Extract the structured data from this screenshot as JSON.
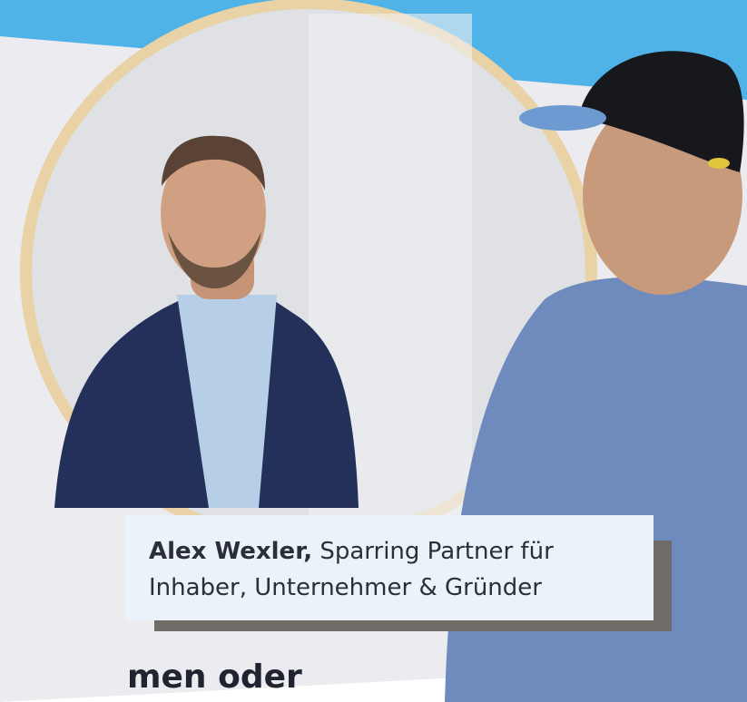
{
  "caption": {
    "name": "Alex Wexler,",
    "role_line1": "Sparring Partner für",
    "role_line2": "Inhaber, Unternehmer & Gründer"
  },
  "cut_text": "men oder",
  "colors": {
    "sky": "#4fb3e8",
    "wall": "#ecebef",
    "mirror_frame": "#e8d2a6",
    "suit": "#23305a",
    "tshirt": "#6f8bbd",
    "caption_bg": "#ecf2f9"
  }
}
